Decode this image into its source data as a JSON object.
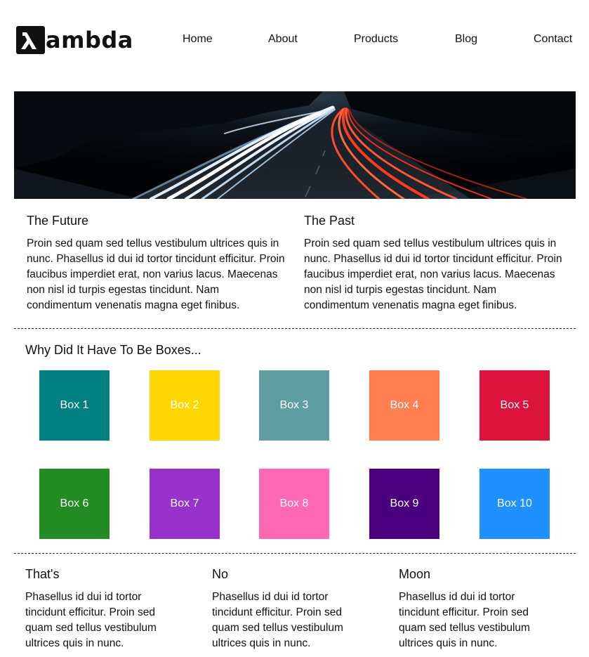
{
  "header": {
    "logo_text": "ambda",
    "logo_mark_icon": "lambda-icon",
    "nav": [
      "Home",
      "About",
      "Products",
      "Blog",
      "Contact"
    ]
  },
  "hero": {
    "image": "highway-light-trails-night"
  },
  "articles": [
    {
      "title": "The Future",
      "body": "Proin sed quam sed tellus vestibulum ultrices quis in nunc. Phasellus id dui id tortor tincidunt efficitur. Proin faucibus imperdiet erat, non varius lacus. Maecenas non nisl id turpis egestas tincidunt. Nam condimentum venenatis magna eget finibus."
    },
    {
      "title": "The Past",
      "body": "Proin sed quam sed tellus vestibulum ultrices quis in nunc. Phasellus id dui id tortor tincidunt efficitur. Proin faucibus imperdiet erat, non varius lacus. Maecenas non nisl id turpis egestas tincidunt. Nam condimentum venenatis magna eget finibus."
    }
  ],
  "boxes_section": {
    "title": "Why Did It Have To Be Boxes...",
    "boxes": [
      {
        "label": "Box 1",
        "color": "#008080"
      },
      {
        "label": "Box 2",
        "color": "#FFD700"
      },
      {
        "label": "Box 3",
        "color": "#5F9EA0"
      },
      {
        "label": "Box 4",
        "color": "#FF7F50"
      },
      {
        "label": "Box 5",
        "color": "#DC143C"
      },
      {
        "label": "Box 6",
        "color": "#228B22"
      },
      {
        "label": "Box 7",
        "color": "#9932CC"
      },
      {
        "label": "Box 8",
        "color": "#FF69B4"
      },
      {
        "label": "Box 9",
        "color": "#4B0082"
      },
      {
        "label": "Box 10",
        "color": "#1E90FF"
      }
    ]
  },
  "bottom_columns": [
    {
      "title": "That's",
      "body": "Phasellus id dui id tortor tincidunt efficitur. Proin sed quam sed tellus vestibulum ultrices quis in nunc."
    },
    {
      "title": "No",
      "body": "Phasellus id dui id tortor tincidunt efficitur. Proin sed quam sed tellus vestibulum ultrices quis in nunc."
    },
    {
      "title": "Moon",
      "body": "Phasellus id dui id tortor tincidunt efficitur. Proin sed quam sed tellus vestibulum ultrices quis in nunc."
    }
  ]
}
